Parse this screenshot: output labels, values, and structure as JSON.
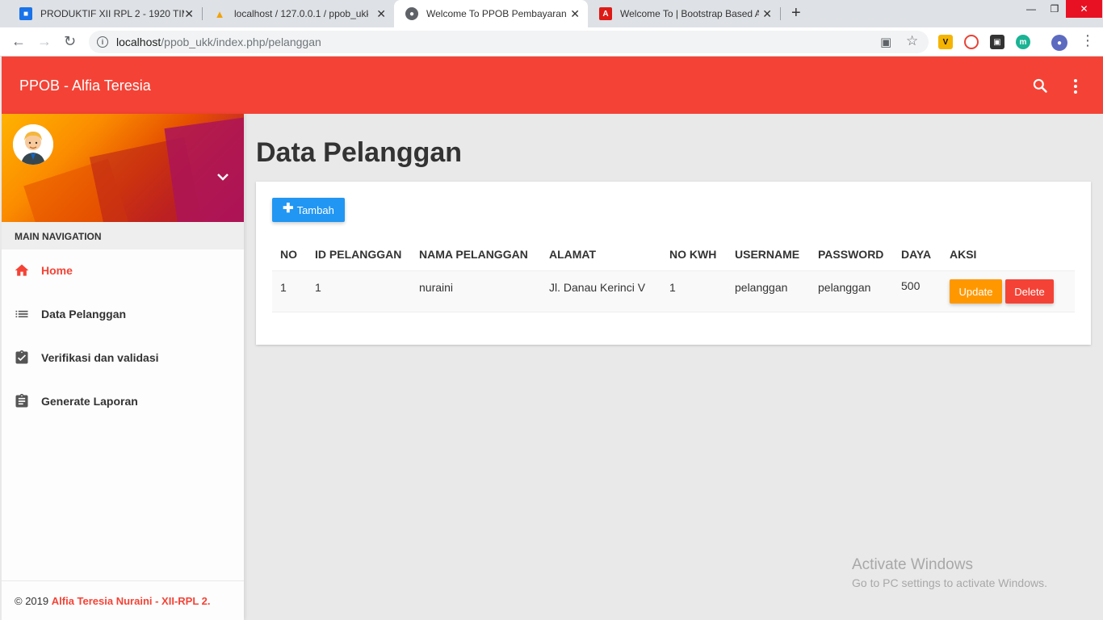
{
  "browser": {
    "tabs": [
      {
        "title": "PRODUKTIF XII RPL 2 - 1920 TIM",
        "icon": "classroom-icon",
        "color": "#1a73e8"
      },
      {
        "title": "localhost / 127.0.0.1 / ppob_ukk",
        "icon": "phpmyadmin-icon",
        "color": "#f0a30a"
      },
      {
        "title": "Welcome To PPOB Pembayaran",
        "icon": "globe-icon",
        "color": "#5f6368"
      },
      {
        "title": "Welcome To | Bootstrap Based A",
        "icon": "angular-icon",
        "color": "#dd1b16"
      }
    ],
    "active_tab": 2,
    "url_host": "localhost",
    "url_path": "/ppob_ukk/index.php/pelanggan"
  },
  "header": {
    "brand": "PPOB - Alfia Teresia",
    "color": "#f44336"
  },
  "sidebar": {
    "nav_header": "MAIN NAVIGATION",
    "items": [
      {
        "label": "Home",
        "icon": "home-icon"
      },
      {
        "label": "Data Pelanggan",
        "icon": "list-icon"
      },
      {
        "label": "Verifikasi dan validasi",
        "icon": "assignment-check-icon"
      },
      {
        "label": "Generate Laporan",
        "icon": "assignment-icon"
      }
    ],
    "footer_prefix": "© 2019",
    "footer_author": "Alfia Teresia Nuraini - XII-RPL 2."
  },
  "main": {
    "title": "Data Pelanggan",
    "add_button": "Tambah",
    "table": {
      "columns": [
        "NO",
        "ID PELANGGAN",
        "NAMA PELANGGAN",
        "ALAMAT",
        "NO KWH",
        "USERNAME",
        "PASSWORD",
        "DAYA",
        "AKSI"
      ],
      "rows": [
        {
          "no": "1",
          "id": "1",
          "nama": "nuraini",
          "alamat": "Jl. Danau Kerinci V",
          "kwh": "1",
          "username": "pelanggan",
          "password": "pelanggan",
          "daya": "500"
        }
      ],
      "update_label": "Update",
      "delete_label": "Delete"
    }
  },
  "watermark": {
    "title": "Activate Windows",
    "subtitle": "Go to PC settings to activate Windows."
  }
}
